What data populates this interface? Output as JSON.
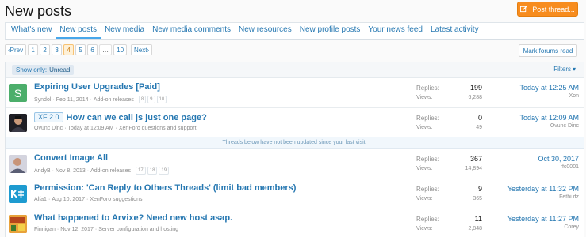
{
  "page": {
    "title": "New posts",
    "post_thread_label": "Post thread..."
  },
  "tabs": [
    {
      "label": "What's new"
    },
    {
      "label": "New posts",
      "active": true
    },
    {
      "label": "New media"
    },
    {
      "label": "New media comments"
    },
    {
      "label": "New resources"
    },
    {
      "label": "New profile posts"
    },
    {
      "label": "Your news feed"
    },
    {
      "label": "Latest activity"
    }
  ],
  "pager": {
    "prev": "Prev",
    "pages": [
      "1",
      "2",
      "3",
      "4",
      "5",
      "6",
      "…",
      "10"
    ],
    "current": "4",
    "next": "Next"
  },
  "mark_read_label": "Mark forums read",
  "filter": {
    "label": "Show only:",
    "value": "Unread",
    "filters_label": "Filters"
  },
  "divider_text": "Threads below have not been updated since your last visit.",
  "threads": [
    {
      "title": "Expiring User Upgrades [Paid]",
      "prefix": "",
      "author": "Syndol",
      "date": "Feb 11, 2014",
      "forum": "Add-on releases",
      "pages": [
        "8",
        "9",
        "10"
      ],
      "replies_label": "Replies:",
      "replies": "199",
      "views_label": "Views:",
      "views": "6,288",
      "last_date": "Today at 12:25 AM",
      "last_user": "Xon",
      "avatar": {
        "type": "letter",
        "letter": "S",
        "color": "#4cae6b"
      }
    },
    {
      "title": "How can we call js just one page?",
      "prefix": "XF 2.0",
      "author": "Ovunc Dinc",
      "date": "Today at 12:09 AM",
      "forum": "XenForo questions and support",
      "pages": [],
      "replies_label": "Replies:",
      "replies": "0",
      "views_label": "Views:",
      "views": "49",
      "last_date": "Today at 12:09 AM",
      "last_user": "Ovunc Dinc",
      "avatar": {
        "type": "photo",
        "color": "#1f1f25"
      }
    },
    {
      "title": "Convert Image All",
      "prefix": "",
      "author": "AndyB",
      "date": "Nov 8, 2013",
      "forum": "Add-on releases",
      "pages": [
        "17",
        "18",
        "19"
      ],
      "replies_label": "Replies:",
      "replies": "367",
      "views_label": "Views:",
      "views": "14,894",
      "last_date": "Oct 30, 2017",
      "last_user": "rfc0001",
      "avatar": {
        "type": "photo",
        "color": "#c9c9d4"
      }
    },
    {
      "title": "Permission: 'Can Reply to Others Threads' (limit bad members)",
      "prefix": "",
      "author": "Alfa1",
      "date": "Aug 10, 2017",
      "forum": "XenForo suggestions",
      "pages": [],
      "replies_label": "Replies:",
      "replies": "9",
      "views_label": "Views:",
      "views": "365",
      "last_date": "Yesterday at 11:32 PM",
      "last_user": "Fethi.dz",
      "avatar": {
        "type": "logo",
        "color": "#1e9bd0"
      }
    },
    {
      "title": "What happened to Arvixe? Need new host asap.",
      "prefix": "",
      "author": "Finnigan",
      "date": "Nov 12, 2017",
      "forum": "Server configuration and hosting",
      "pages": [],
      "replies_label": "Replies:",
      "replies": "11",
      "views_label": "Views:",
      "views": "2,848",
      "last_date": "Yesterday at 11:27 PM",
      "last_user": "Corey",
      "avatar": {
        "type": "photo",
        "color": "#e07a2a"
      }
    }
  ]
}
